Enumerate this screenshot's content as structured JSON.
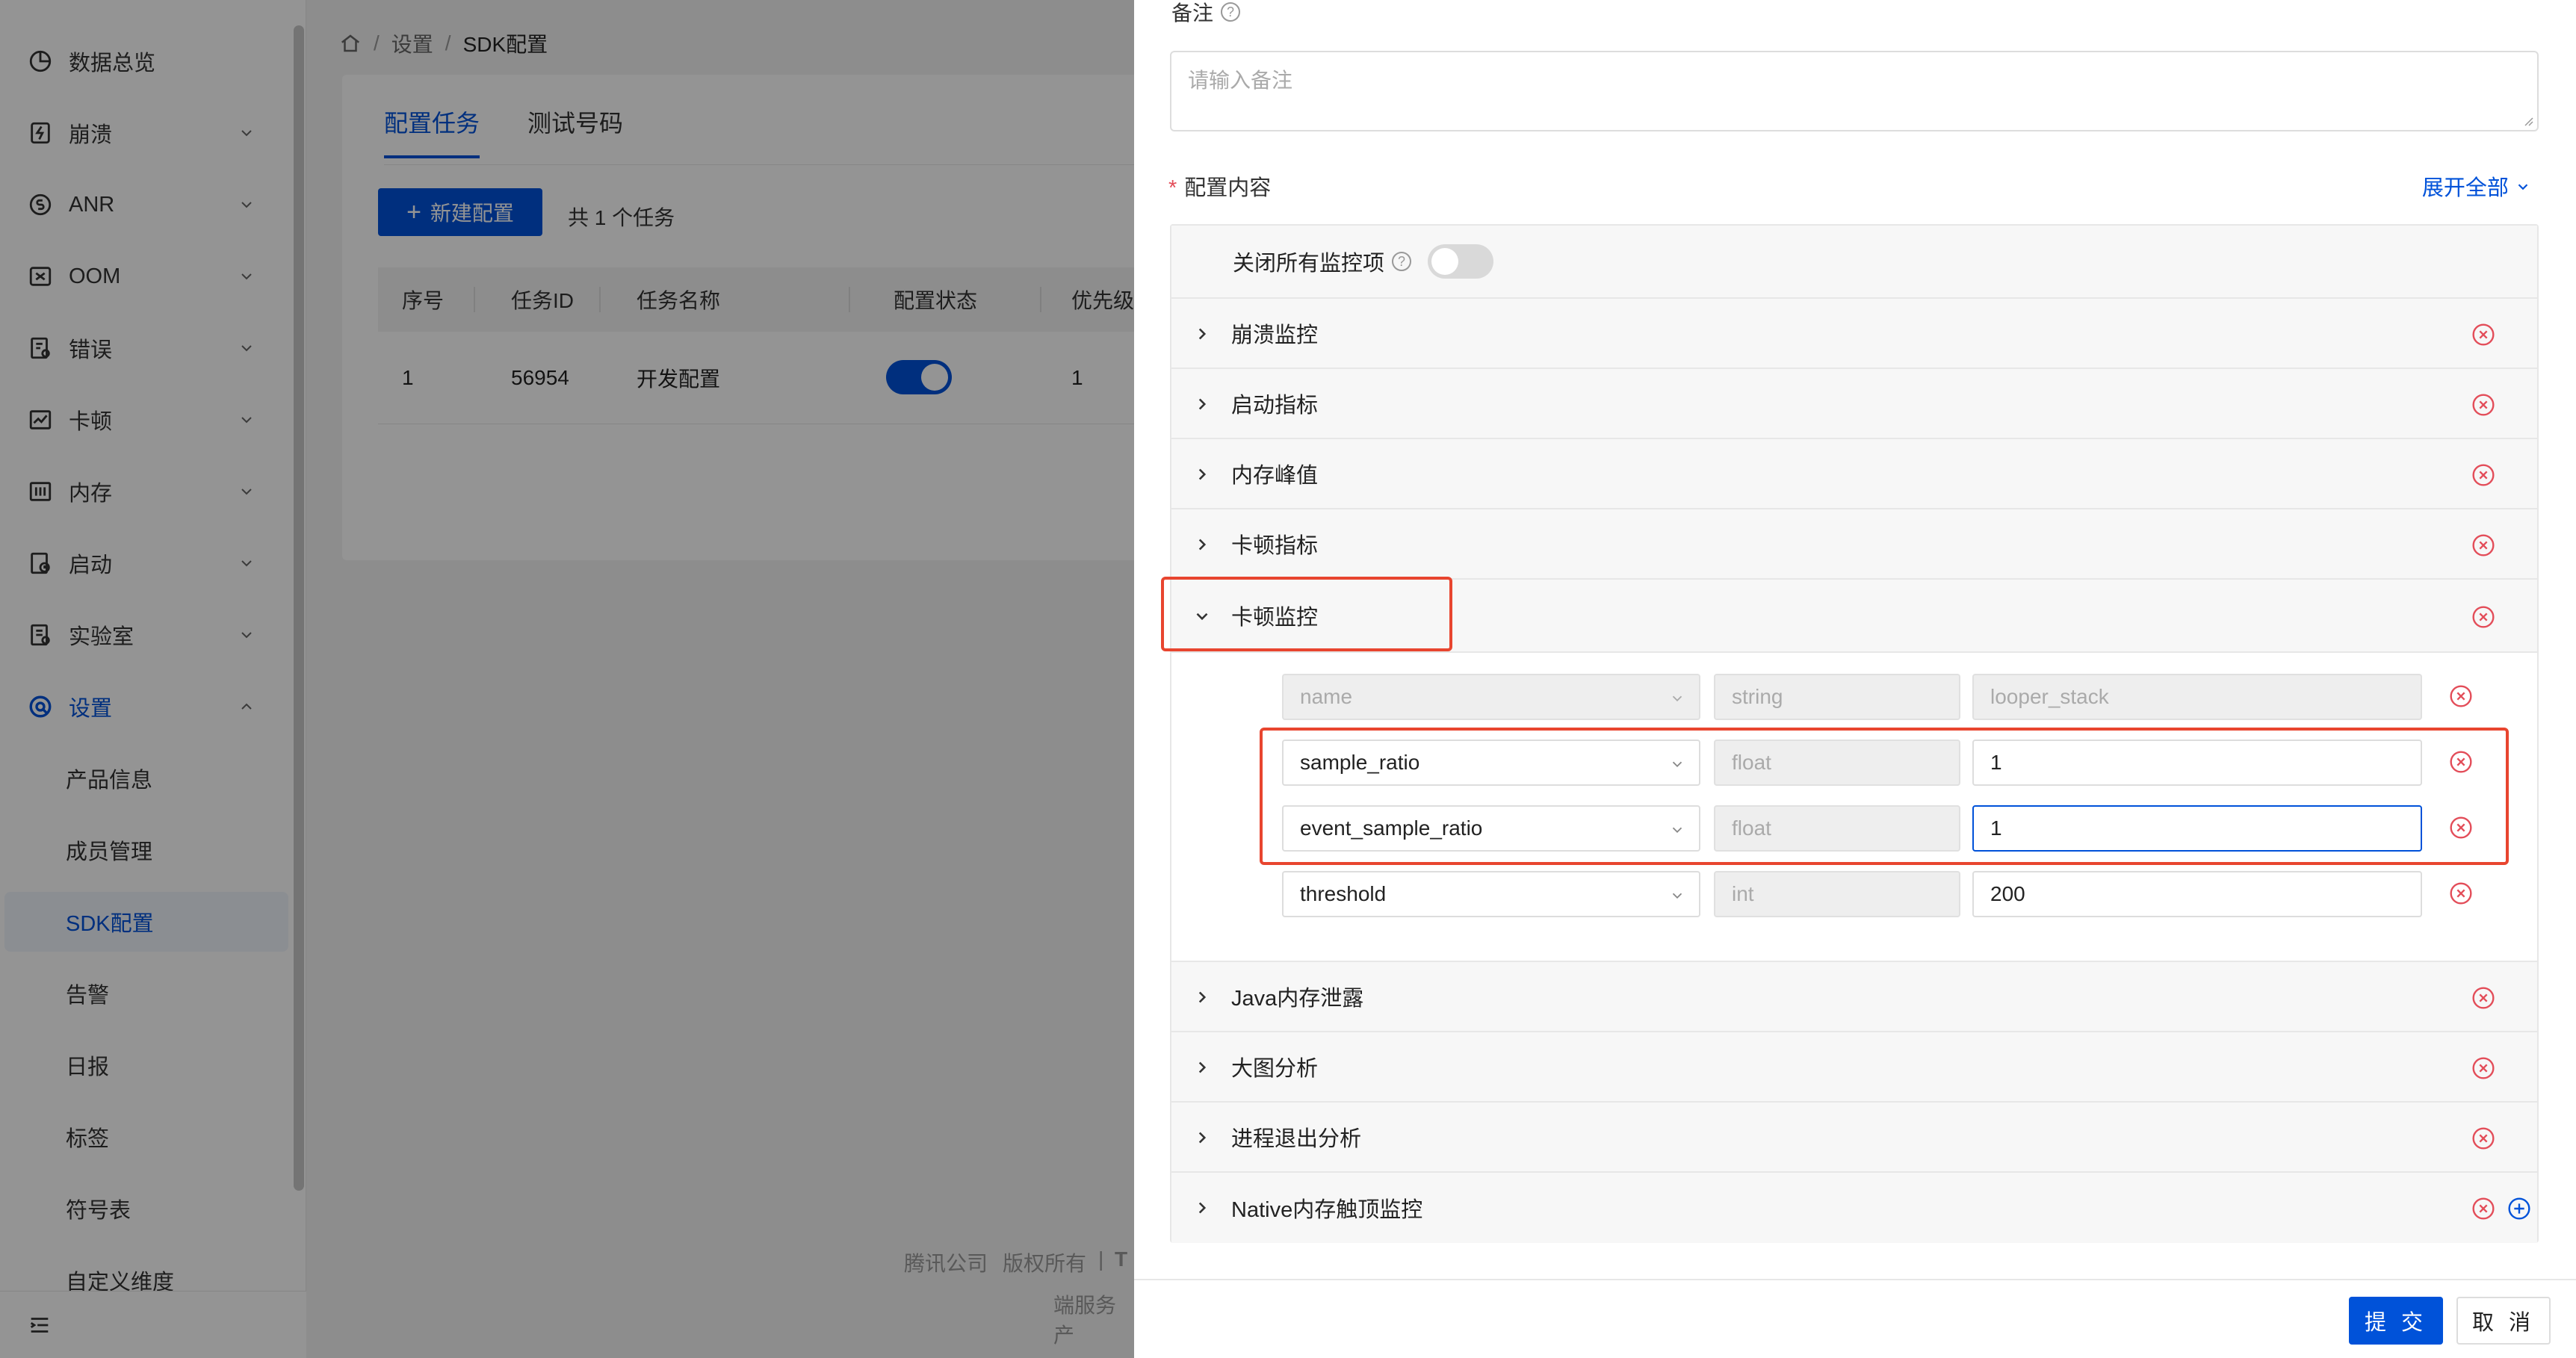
{
  "sidebar": {
    "items": [
      {
        "label": "数据总览",
        "icon": "pie-chart-icon"
      },
      {
        "label": "崩溃",
        "icon": "crash-icon"
      },
      {
        "label": "ANR",
        "icon": "anr-icon"
      },
      {
        "label": "OOM",
        "icon": "oom-icon"
      },
      {
        "label": "错误",
        "icon": "error-icon"
      },
      {
        "label": "卡顿",
        "icon": "lag-chart-icon"
      },
      {
        "label": "内存",
        "icon": "memory-icon"
      },
      {
        "label": "启动",
        "icon": "launch-icon"
      },
      {
        "label": "实验室",
        "icon": "lab-icon"
      },
      {
        "label": "设置",
        "icon": "settings-icon"
      }
    ],
    "sub_items": [
      "产品信息",
      "成员管理",
      "SDK配置",
      "告警",
      "日报",
      "标签",
      "符号表",
      "自定义维度"
    ]
  },
  "breadcrumb": {
    "home": "home-icon",
    "level1": "设置",
    "level2": "SDK配置"
  },
  "tabs": [
    "配置任务",
    "测试号码"
  ],
  "toolbar": {
    "new_button": "新建配置",
    "task_count": "共 1 个任务"
  },
  "table": {
    "headers": [
      "序号",
      "任务ID",
      "任务名称",
      "配置状态",
      "优先级"
    ],
    "rows": [
      {
        "index": "1",
        "task_id": "56954",
        "task_name": "开发配置",
        "status": true,
        "priority": "1"
      }
    ]
  },
  "footer": {
    "company": "腾讯公司",
    "rights": "版权所有",
    "sep": "|",
    "tail": "T",
    "service": "端服务产"
  },
  "drawer": {
    "remark_label": "备注",
    "remark_placeholder": "请输入备注",
    "config_label": "配置内容",
    "required_mark": "*",
    "expand_all": "展开全部",
    "close_all_label": "关闭所有监控项",
    "help_glyph": "?",
    "sections_before": [
      "崩溃监控",
      "启动指标",
      "内存峰值",
      "卡顿指标"
    ],
    "expanded_section": "卡顿监控",
    "params": [
      {
        "key": "name",
        "type": "string",
        "value": "looper_stack",
        "disabled": true
      },
      {
        "key": "sample_ratio",
        "type": "float",
        "value": "1",
        "disabled": false
      },
      {
        "key": "event_sample_ratio",
        "type": "float",
        "value": "1",
        "disabled": false,
        "focused": true
      },
      {
        "key": "threshold",
        "type": "int",
        "value": "200",
        "disabled": false
      }
    ],
    "sections_after": [
      "Java内存泄露",
      "大图分析",
      "进程退出分析",
      "Native内存触顶监控"
    ],
    "submit": "提 交",
    "cancel": "取 消"
  },
  "colors": {
    "primary": "#0052d9",
    "danger": "#e34d59",
    "highlight": "#e8452f"
  }
}
